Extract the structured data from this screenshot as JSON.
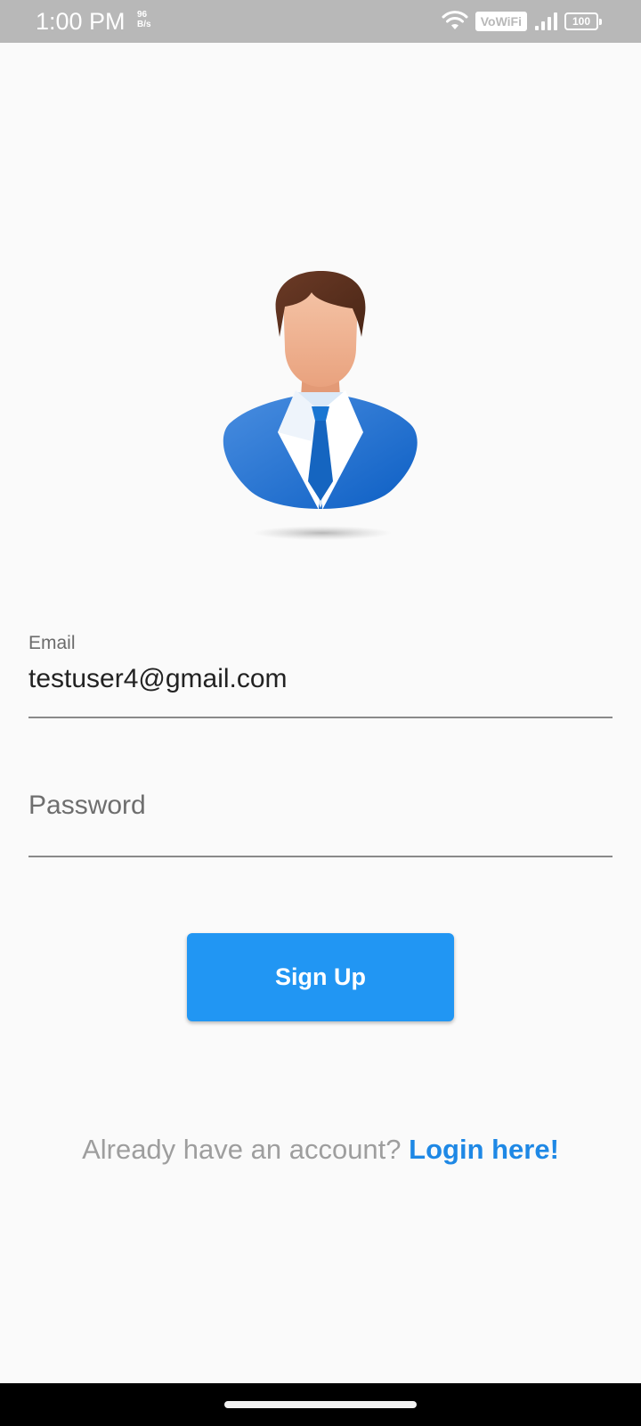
{
  "status_bar": {
    "time": "1:00 PM",
    "net_speed_value": "96",
    "net_speed_unit": "B/s",
    "vowifi_label": "VoWiFi",
    "battery_level": "100"
  },
  "avatar": {
    "icon": "user-avatar-icon"
  },
  "form": {
    "email_label": "Email",
    "email_value": "testuser4@gmail.com",
    "password_placeholder": "Password"
  },
  "signup_button": {
    "label": "Sign Up",
    "color": "#2196f3"
  },
  "login_prompt": {
    "text": "Already have an account?",
    "link_label": "Login here!",
    "link_color": "#1e88e5"
  },
  "colors": {
    "background": "#fafafa",
    "status_bar": "#b8b8b8",
    "nav_bar": "#000000"
  }
}
